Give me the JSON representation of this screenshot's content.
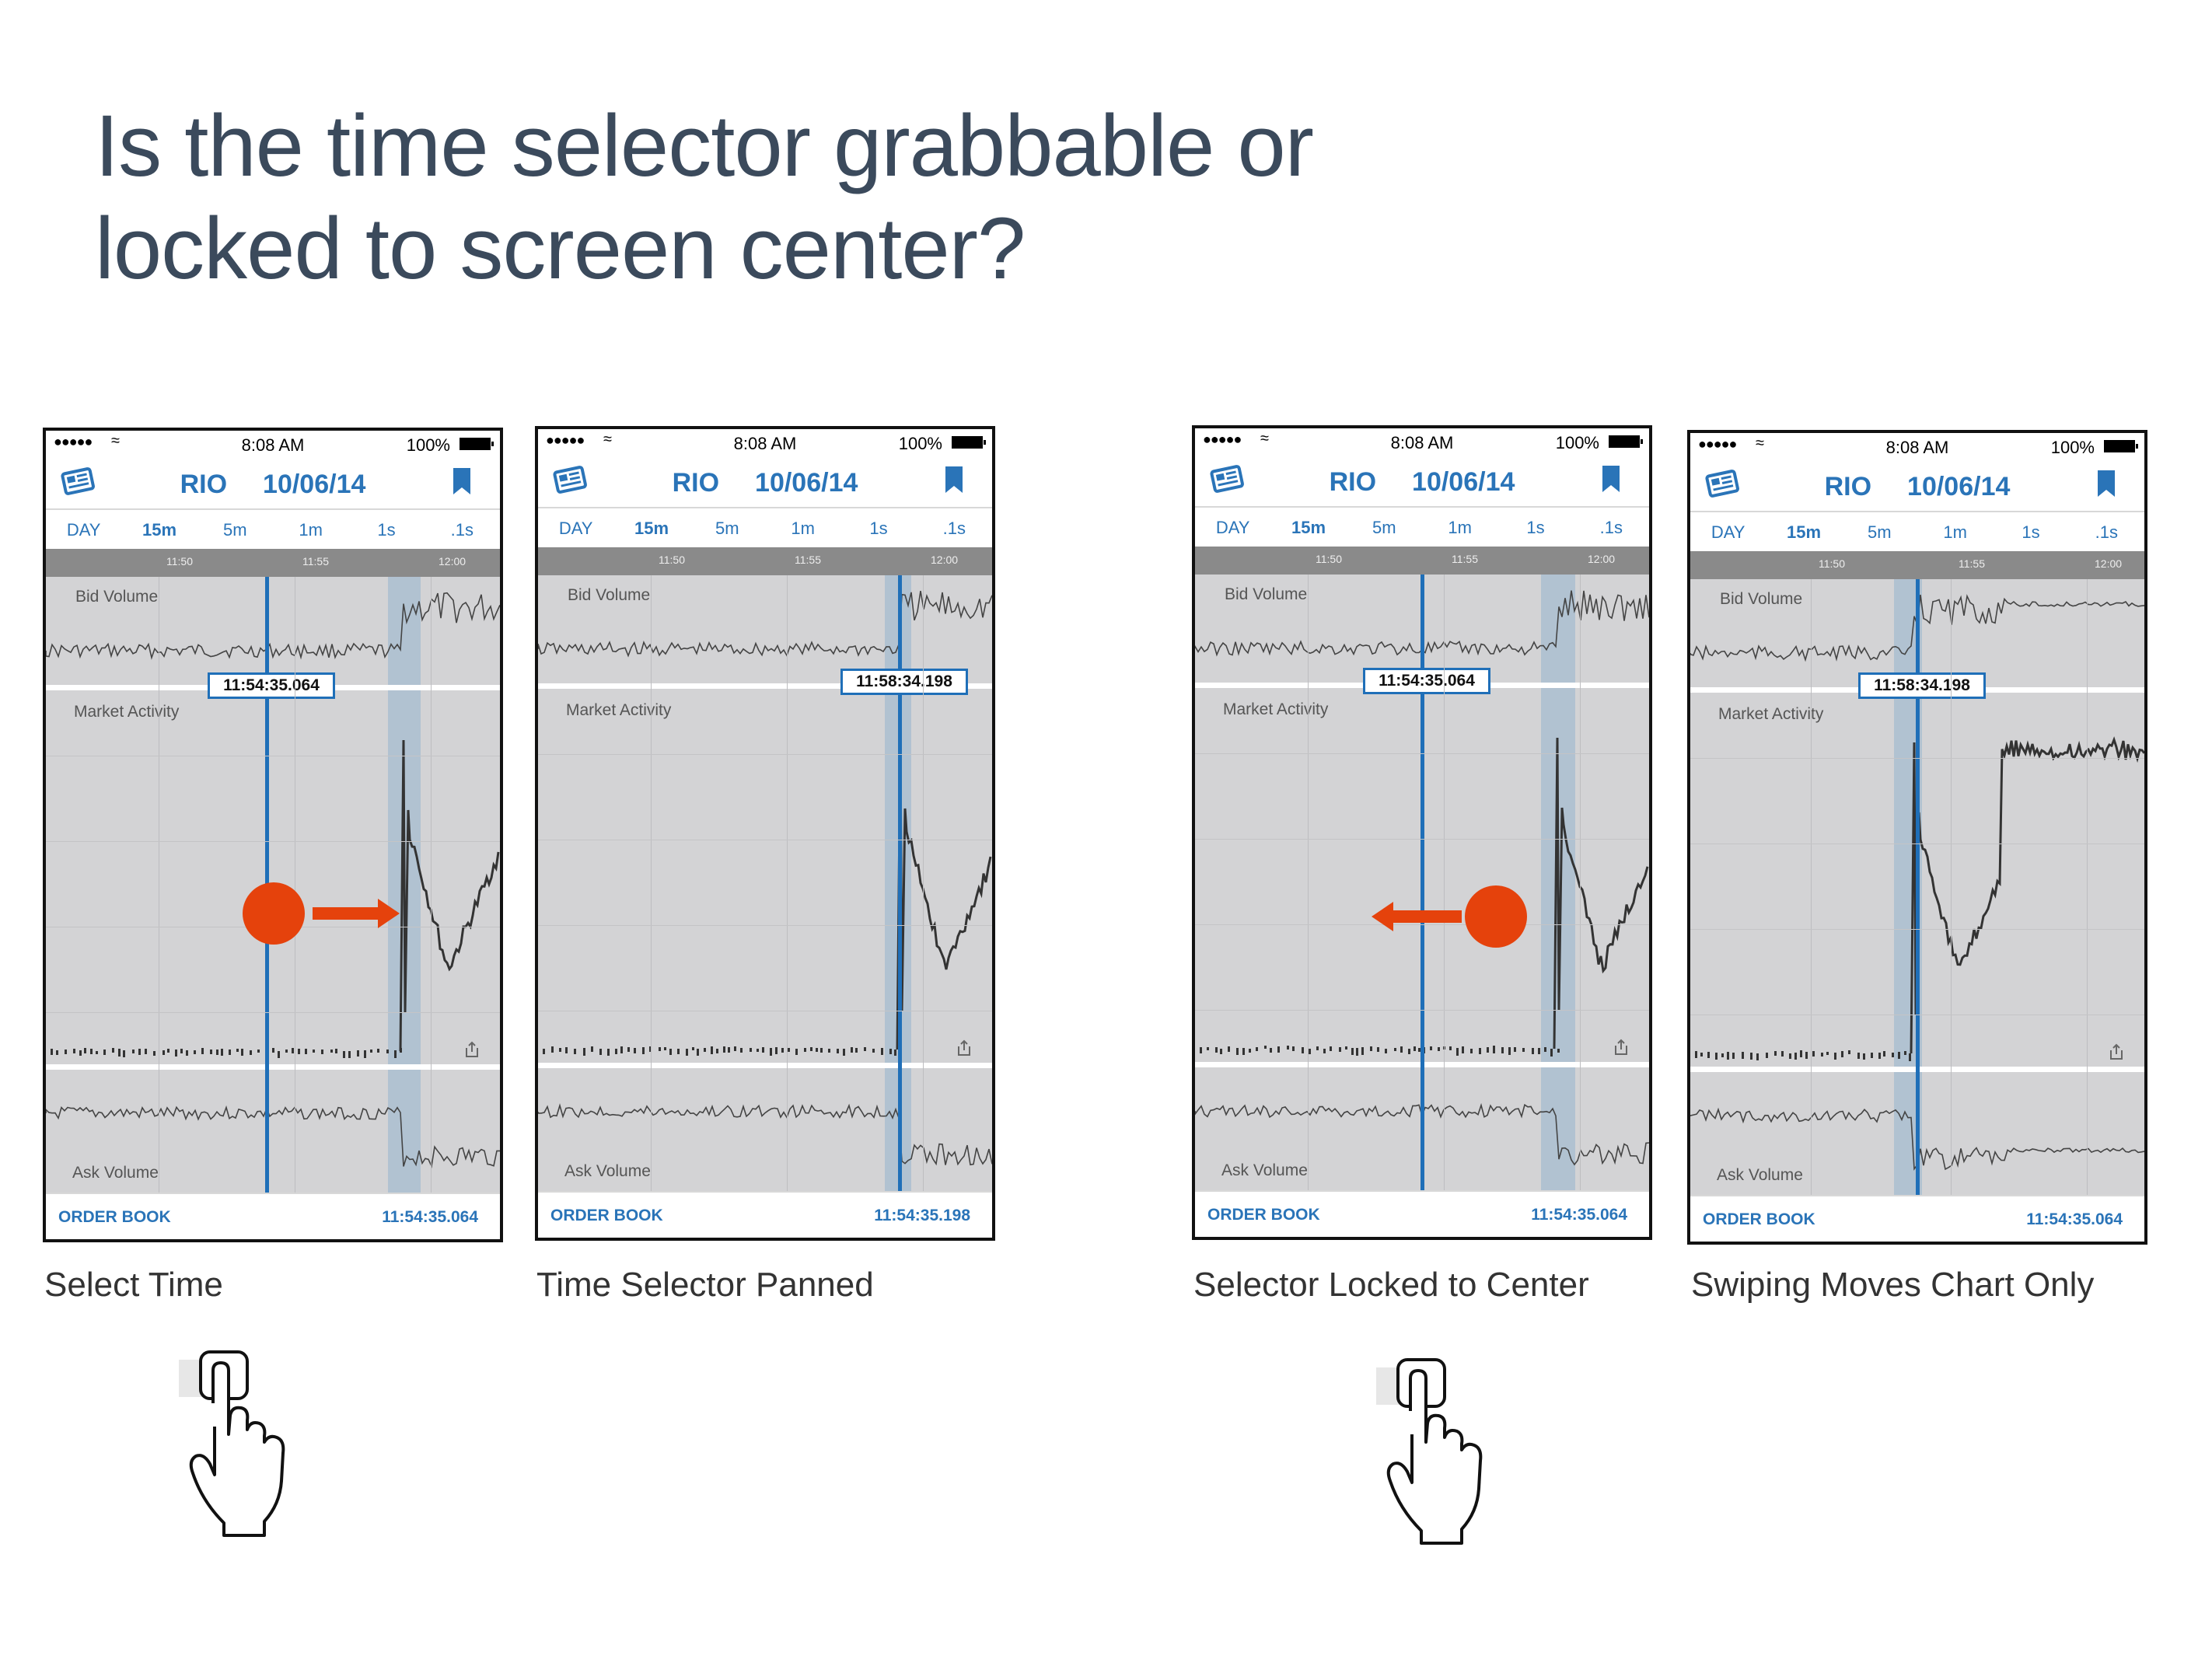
{
  "headline": {
    "line1": "Is the time selector grabbable or",
    "line2": "locked to screen center?"
  },
  "colors": {
    "accent": "#2a74b8",
    "gesture": "#e5420c",
    "chart_bg": "#d3d3d5"
  },
  "icons": [
    "news-icon",
    "bookmark-icon",
    "share-icon",
    "touch-hand-icon",
    "drag-arrow-icon",
    "touch-point-icon"
  ],
  "screens": [
    {
      "status": {
        "signal": "●●●●●",
        "time": "8:08 AM",
        "battery": "100%"
      },
      "nav": {
        "symbol": "RIO",
        "date": "10/06/14"
      },
      "tabs": [
        "DAY",
        "15m",
        "5m",
        "1m",
        "1s",
        ".1s"
      ],
      "axis_ticks": [
        "11:50",
        "11:55",
        "12:00"
      ],
      "labels": {
        "bid": "Bid Volume",
        "market": "Market Activity",
        "ask": "Ask Volume"
      },
      "selector_time": "11:54:35.064",
      "footer": {
        "order_book": "ORDER BOOK",
        "time": "11:54:35.064"
      },
      "caption": "Select Time"
    },
    {
      "status": {
        "signal": "●●●●●",
        "time": "8:08 AM",
        "battery": "100%"
      },
      "nav": {
        "symbol": "RIO",
        "date": "10/06/14"
      },
      "tabs": [
        "DAY",
        "15m",
        "5m",
        "1m",
        "1s",
        ".1s"
      ],
      "axis_ticks": [
        "11:50",
        "11:55",
        "12:00"
      ],
      "labels": {
        "bid": "Bid Volume",
        "market": "Market Activity",
        "ask": "Ask Volume"
      },
      "selector_time": "11:58:34.198",
      "footer": {
        "order_book": "ORDER BOOK",
        "time": "11:54:35.198"
      },
      "caption": "Time Selector Panned"
    },
    {
      "status": {
        "signal": "●●●●●",
        "time": "8:08 AM",
        "battery": "100%"
      },
      "nav": {
        "symbol": "RIO",
        "date": "10/06/14"
      },
      "tabs": [
        "DAY",
        "15m",
        "5m",
        "1m",
        "1s",
        ".1s"
      ],
      "axis_ticks": [
        "11:50",
        "11:55",
        "12:00"
      ],
      "labels": {
        "bid": "Bid Volume",
        "market": "Market Activity",
        "ask": "Ask Volume"
      },
      "selector_time": "11:54:35.064",
      "footer": {
        "order_book": "ORDER BOOK",
        "time": "11:54:35.064"
      },
      "caption": "Selector Locked to Center"
    },
    {
      "status": {
        "signal": "●●●●●",
        "time": "8:08 AM",
        "battery": "100%"
      },
      "nav": {
        "symbol": "RIO",
        "date": "10/06/14"
      },
      "tabs": [
        "DAY",
        "15m",
        "5m",
        "1m",
        "1s",
        ".1s"
      ],
      "axis_ticks": [
        "11:50",
        "11:55",
        "12:00"
      ],
      "labels": {
        "bid": "Bid Volume",
        "market": "Market Activity",
        "ask": "Ask Volume"
      },
      "selector_time": "11:58:34.198",
      "footer": {
        "order_book": "ORDER BOOK",
        "time": "11:54:35.064"
      },
      "caption": "Swiping Moves Chart Only"
    }
  ]
}
